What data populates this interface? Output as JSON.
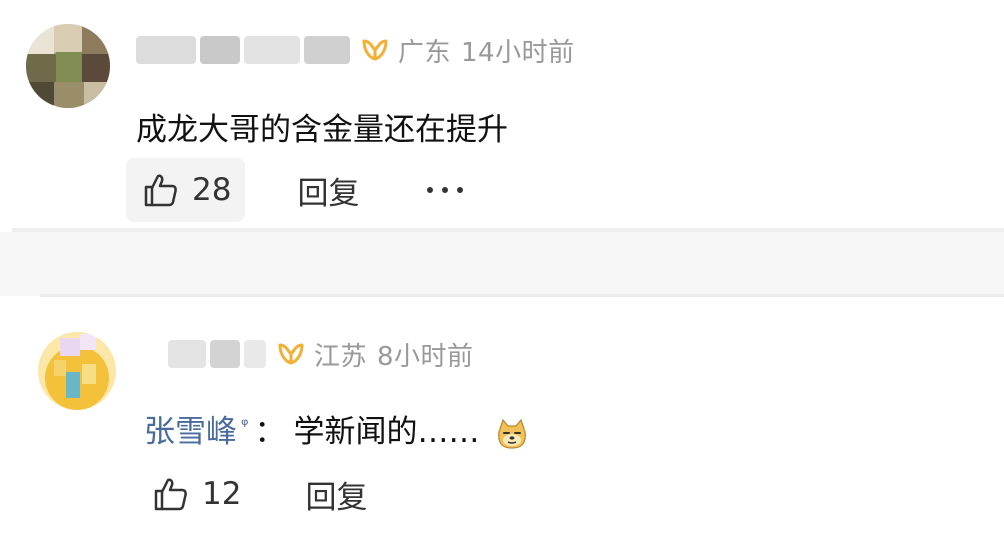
{
  "comments": [
    {
      "location": "广东",
      "time": "14小时前",
      "text": "成龙大哥的含金量还在提升",
      "likes": "28",
      "reply_label": "回复",
      "more_label": "···",
      "badge_color": "#f2b134"
    },
    {
      "location": "江苏",
      "time": "8小时前",
      "mention": "张雪峰",
      "mention_suffix": "ᵠ",
      "separator": "：",
      "text": "学新闻的……",
      "emoji": "doge-emoji",
      "likes": "12",
      "reply_label": "回复",
      "badge_color": "#f2b134"
    }
  ],
  "colors": {
    "meta_gray": "#999999",
    "mention_blue": "#4a6b9e",
    "separator_bg": "#f7f7f7"
  }
}
